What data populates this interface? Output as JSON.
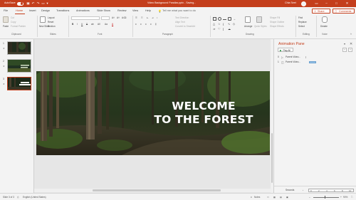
{
  "titlebar": {
    "autosave_label": "AutoSave",
    "toggle_state": "On",
    "doc_title": "Video Background Parallax.pptx  -  Saving...",
    "user": "Chia Seet",
    "colors": {
      "accent": "#c43e1c"
    }
  },
  "tabs": [
    "File",
    "Home",
    "Insert",
    "Design",
    "Transitions",
    "Animations",
    "Slide Show",
    "Review",
    "View",
    "Help"
  ],
  "active_tab": "Home",
  "tell_me": "Tell me what you want to do",
  "share_label": "Share",
  "comments_label": "Comments",
  "ribbon": {
    "clipboard": {
      "paste": "Paste",
      "cut": "Cut",
      "copy": "Copy",
      "format_painter": "Format Painter",
      "label": "Clipboard"
    },
    "slides": {
      "new_slide": "New Slide",
      "layout": "Layout",
      "reset": "Reset",
      "section": "Section",
      "label": "Slides"
    },
    "font": {
      "label": "Font",
      "bold": "B",
      "italic": "I",
      "underline": "U",
      "strike": "S",
      "shadow": "ab",
      "spacing": "AV",
      "case": "Aa",
      "color": "A"
    },
    "paragraph": {
      "label": "Paragraph",
      "text_direction": "Text Direction",
      "align_text": "Align Text",
      "smartart": "Convert to SmartArt"
    },
    "drawing": {
      "label": "Drawing",
      "arrange": "Arrange",
      "quick_styles": "Quick Styles",
      "shape_fill": "Shape Fill",
      "shape_outline": "Shape Outline",
      "shape_effects": "Shape Effects"
    },
    "editing": {
      "label": "Editing",
      "find": "Find",
      "replace": "Replace",
      "select": "Select"
    },
    "voice": {
      "label": "Voice",
      "dictate": "Dictate"
    }
  },
  "slides": [
    {
      "num": "1",
      "has_animation": true
    },
    {
      "num": "2",
      "has_animation": true
    },
    {
      "num": "3",
      "has_animation": true,
      "selected": true
    }
  ],
  "slide": {
    "title_line1": "WELCOME",
    "title_line2": "TO THE FOREST"
  },
  "animation_pane": {
    "title": "Animation Pane",
    "play_all": "Play All",
    "items": [
      {
        "num": "0",
        "label": "Parent Video..."
      },
      {
        "num": "1",
        "label": "Parent Video..."
      }
    ],
    "seconds_label": "Seconds",
    "timeline": [
      "0",
      "2",
      "4",
      "6",
      "8",
      "10"
    ]
  },
  "status": {
    "slide_of": "Slide 3 of 3",
    "language": "English (United States)",
    "notes": "Notes",
    "zoom": "90%"
  }
}
